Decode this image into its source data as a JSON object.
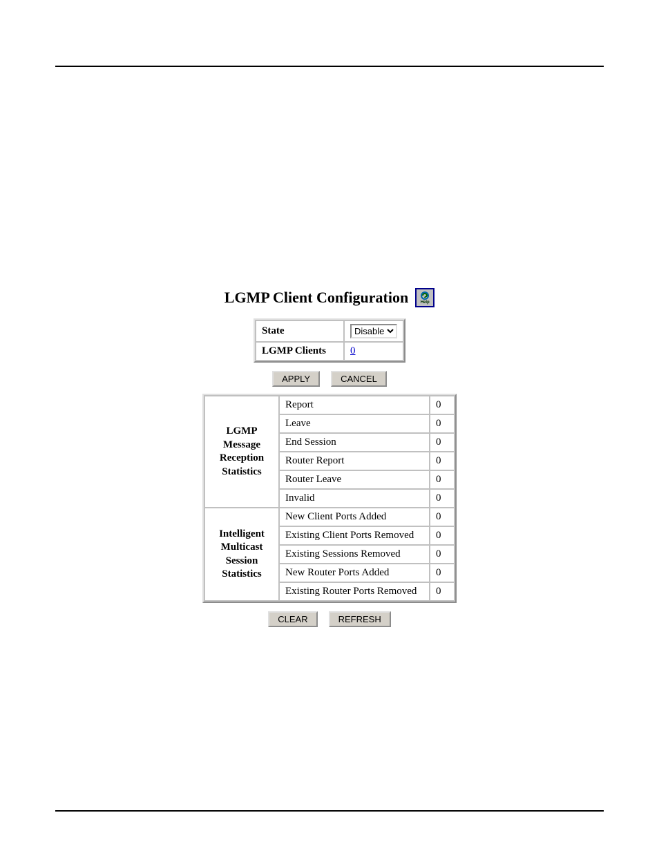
{
  "title": "LGMP Client Configuration",
  "help_label": "Help",
  "form": {
    "state_label": "State",
    "state_value": "Disable",
    "clients_label": "LGMP Clients",
    "clients_value": "0"
  },
  "buttons": {
    "apply": "APPLY",
    "cancel": "CANCEL",
    "clear": "CLEAR",
    "refresh": "REFRESH"
  },
  "stats": {
    "reception": {
      "heading": "LGMP Message Reception Statistics",
      "rows": [
        {
          "label": "Report",
          "value": "0"
        },
        {
          "label": "Leave",
          "value": "0"
        },
        {
          "label": "End Session",
          "value": "0"
        },
        {
          "label": "Router Report",
          "value": "0"
        },
        {
          "label": "Router Leave",
          "value": "0"
        },
        {
          "label": "Invalid",
          "value": "0"
        }
      ]
    },
    "session": {
      "heading": "Intelligent Multicast Session Statistics",
      "rows": [
        {
          "label": "New Client Ports Added",
          "value": "0"
        },
        {
          "label": "Existing Client Ports Removed",
          "value": "0"
        },
        {
          "label": "Existing Sessions Removed",
          "value": "0"
        },
        {
          "label": "New Router Ports Added",
          "value": "0"
        },
        {
          "label": "Existing Router Ports Removed",
          "value": "0"
        }
      ]
    }
  }
}
